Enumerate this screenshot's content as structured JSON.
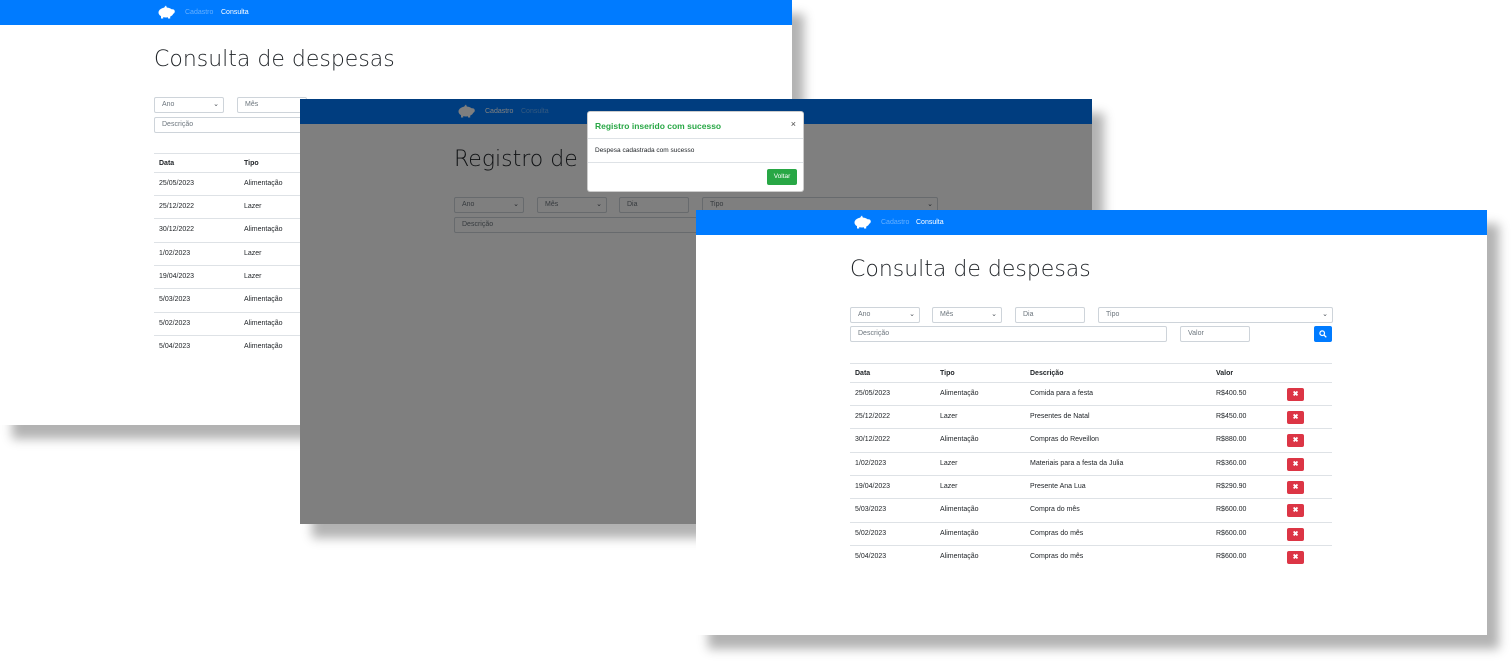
{
  "nav": {
    "cadastro": "Cadastro",
    "consulta": "Consulta"
  },
  "consulta": {
    "title": "Consulta de despesas",
    "filters": {
      "ano": "Ano",
      "mes": "Mês",
      "dia": "Dia",
      "tipo": "Tipo",
      "descricao": "Descrição",
      "valor": "Valor"
    },
    "headers": {
      "data": "Data",
      "tipo": "Tipo",
      "descricao": "Descrição",
      "valor": "Valor"
    },
    "rows": [
      {
        "data": "25/05/2023",
        "tipo": "Alimentação",
        "descricao": "Comida para a festa",
        "valor": "R$400.50"
      },
      {
        "data": "25/12/2022",
        "tipo": "Lazer",
        "descricao": "Presentes de Natal",
        "valor": "R$450.00"
      },
      {
        "data": "30/12/2022",
        "tipo": "Alimentação",
        "descricao": "Compras do Reveillon",
        "valor": "R$880.00"
      },
      {
        "data": "1/02/2023",
        "tipo": "Lazer",
        "descricao": "Materiais para a festa da Julia",
        "valor": "R$360.00"
      },
      {
        "data": "19/04/2023",
        "tipo": "Lazer",
        "descricao": "Presente Ana Lua",
        "valor": "R$290.90"
      },
      {
        "data": "5/03/2023",
        "tipo": "Alimentação",
        "descricao": "Compra do mês",
        "valor": "R$600.00"
      },
      {
        "data": "5/02/2023",
        "tipo": "Alimentação",
        "descricao": "Compras do mês",
        "valor": "R$600.00"
      },
      {
        "data": "5/04/2023",
        "tipo": "Alimentação",
        "descricao": "Compras do mês",
        "valor": "R$600.00"
      }
    ],
    "delete_label": "✖"
  },
  "registro": {
    "title": "Registro de n",
    "filters": {
      "ano": "Ano",
      "mes": "Mês",
      "dia": "Dia",
      "tipo": "Tipo",
      "descricao": "Descrição"
    }
  },
  "modal": {
    "title": "Registro inserido com sucesso",
    "close": "×",
    "body": "Despesa cadastrada com sucesso",
    "button": "Voltar"
  },
  "icons": {
    "brand": "piggy-bank-icon",
    "search": "search-icon",
    "delete": "close-icon",
    "dropdown": "chevron-down-icon"
  },
  "colors": {
    "primary": "#007bff",
    "success": "#28a745",
    "danger": "#dc3545"
  }
}
